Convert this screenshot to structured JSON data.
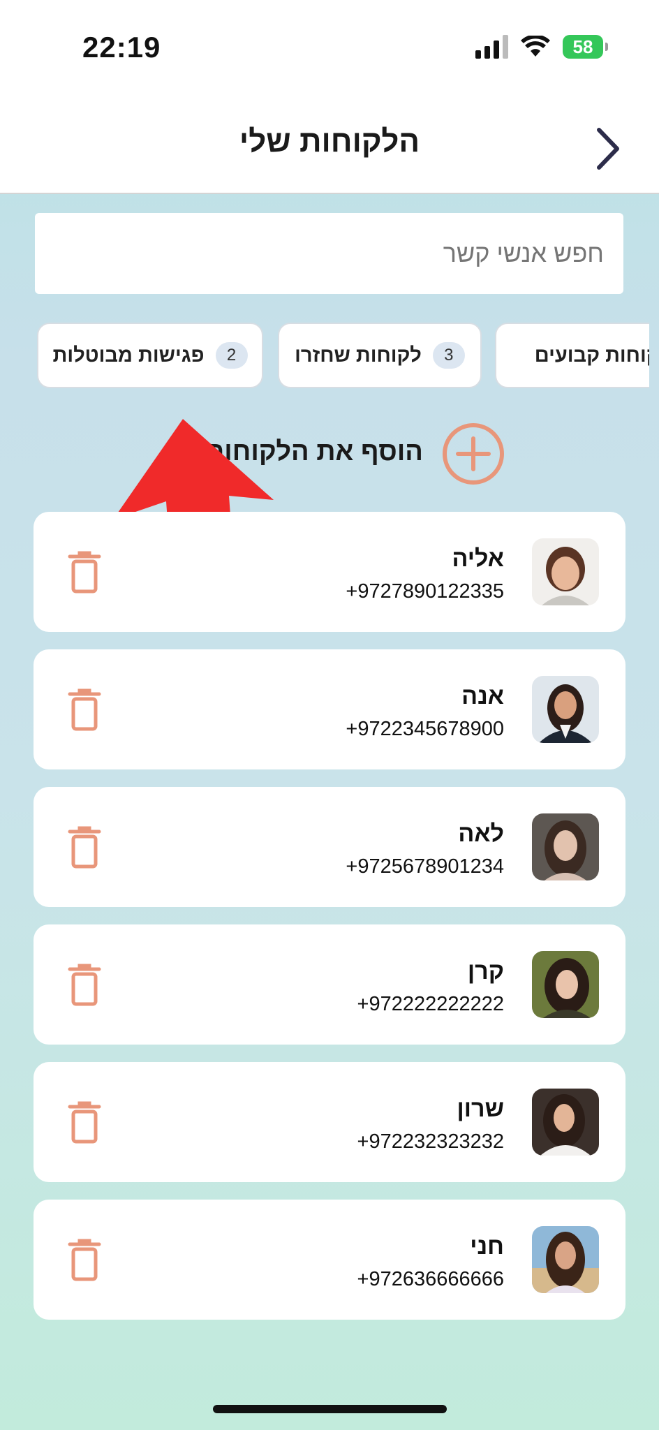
{
  "status_bar": {
    "time": "22:19",
    "battery": "58"
  },
  "header": {
    "title": "הלקוחות שלי"
  },
  "search": {
    "placeholder": "חפש אנשי קשר"
  },
  "filter_chips": [
    {
      "label": "פגישות מבוטלות",
      "count": "2"
    },
    {
      "label": "לקוחות שחזרו",
      "count": "3"
    },
    {
      "label": "לקוחות קבועים"
    }
  ],
  "add_client": {
    "label": "הוסף את הלקוחות"
  },
  "contacts": [
    {
      "name": "אליה",
      "phone": "+9727890122335"
    },
    {
      "name": "אנה",
      "phone": "+9722345678900"
    },
    {
      "name": "לאה",
      "phone": "+9725678901234"
    },
    {
      "name": "קרן",
      "phone": "+972222222222"
    },
    {
      "name": "שרון",
      "phone": "+972232323232"
    },
    {
      "name": "חני",
      "phone": "+972636666666"
    }
  ],
  "colors": {
    "accent": "#e8967a",
    "arrow": "#f02a2a",
    "title": "#1a1a1a"
  }
}
